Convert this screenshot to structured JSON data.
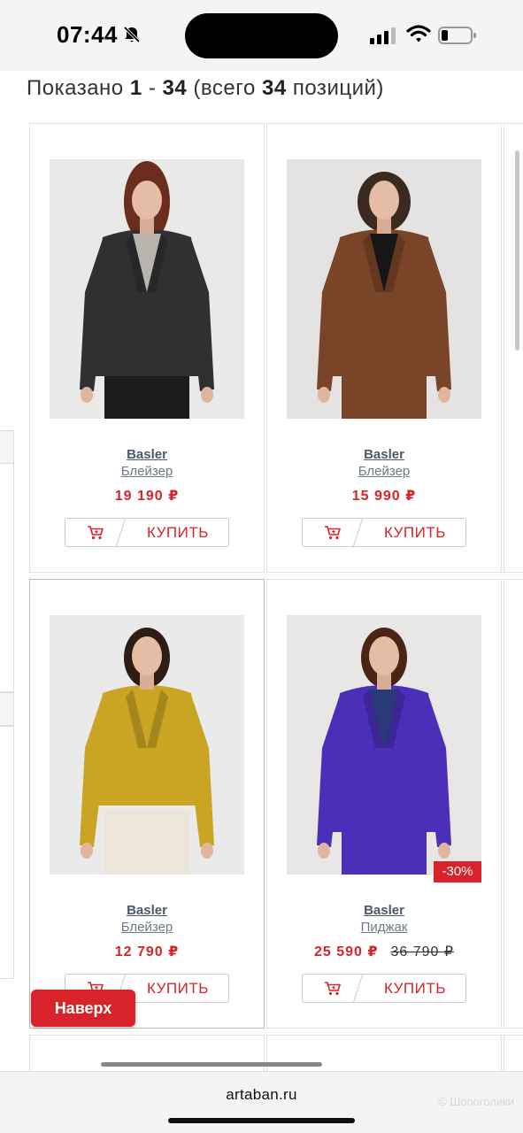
{
  "status_bar": {
    "time": "07:44"
  },
  "listing": {
    "shown_label": "Показано",
    "range_start": "1",
    "range_sep": "-",
    "range_end": "34",
    "total_open": "(всего",
    "total": "34",
    "total_close": "позиций)"
  },
  "products": [
    {
      "brand": "Basler",
      "type": "Блейзер",
      "price": "19 190 ₽",
      "old_price": "",
      "badge": "",
      "buy_label": "КУПИТЬ",
      "colors": {
        "garment": "#2f3032",
        "shirt": "#b7b5ae",
        "bottom": "#1c1c1e",
        "hair": "#6b2e1c",
        "bg": "#e9e9e7"
      }
    },
    {
      "brand": "Basler",
      "type": "Блейзер",
      "price": "15 990 ₽",
      "old_price": "",
      "badge": "",
      "buy_label": "КУПИТЬ",
      "colors": {
        "garment": "#7a4428",
        "shirt": "#161616",
        "bottom": "#7a4428",
        "hair": "#3a2a20",
        "bg": "#e4e3e1"
      }
    },
    {
      "brand": "Basler",
      "type": "Блейзер",
      "price": "12 790 ₽",
      "old_price": "",
      "badge": "",
      "buy_label": "КУПИТЬ",
      "colors": {
        "garment": "#c9a523",
        "shirt": "#c9a523",
        "bottom": "#ece6d8",
        "hair": "#2d1d14",
        "bg": "#eaeaea"
      }
    },
    {
      "brand": "Basler",
      "type": "Пиджак",
      "price": "25 590 ₽",
      "old_price": "36 790 ₽",
      "badge": "-30%",
      "buy_label": "КУПИТЬ",
      "colors": {
        "garment": "#4a2fb8",
        "shirt": "#2a3a78",
        "bottom": "#4a2fb8",
        "hair": "#4a2414",
        "bg": "#e8e7e5"
      }
    }
  ],
  "back_to_top": "Наверх",
  "browser": {
    "url": "artaban.ru"
  },
  "watermark": "© Шопоголики",
  "icons": {
    "cart": "cart-icon",
    "bell": "bell-slash-icon",
    "signal": "signal-icon",
    "wifi": "wifi-icon",
    "battery": "battery-icon"
  },
  "accent_color": "#d8232a"
}
